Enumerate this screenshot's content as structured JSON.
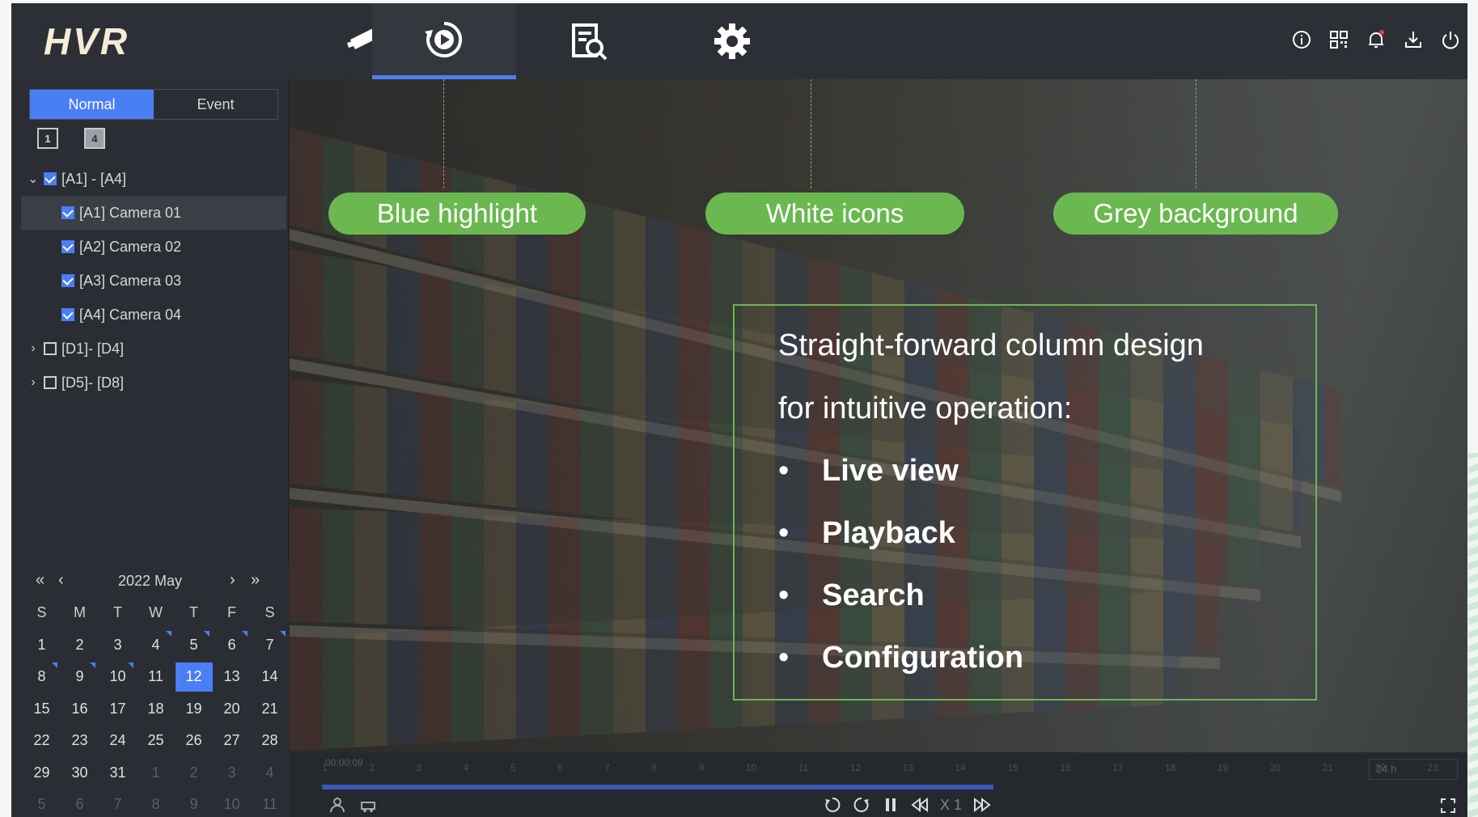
{
  "app": {
    "logo": "HVR"
  },
  "nav": [
    {
      "name": "live-view",
      "icon": "camera-icon"
    },
    {
      "name": "playback",
      "icon": "playback-icon",
      "active": true
    },
    {
      "name": "search",
      "icon": "search-file-icon"
    },
    {
      "name": "configuration",
      "icon": "gear-icon"
    }
  ],
  "header_icons": [
    "info-icon",
    "qr-code-icon",
    "bell-icon",
    "download-icon",
    "power-icon"
  ],
  "sidebar": {
    "tabs": {
      "normal": "Normal",
      "event": "Event"
    },
    "layouts": {
      "one": "1",
      "four": "4"
    },
    "tree": {
      "group_a": "[A1] - [A4]",
      "cameras": [
        "[A1] Camera 01",
        "[A2] Camera 02",
        "[A3] Camera 03",
        "[A4] Camera 04"
      ],
      "group_d1": "[D1]- [D4]",
      "group_d5": "[D5]- [D8]"
    }
  },
  "calendar": {
    "title": "2022 May",
    "nav": {
      "prev_year": "«",
      "prev_month": "‹",
      "next_month": "›",
      "next_year": "»"
    },
    "dow": [
      "S",
      "M",
      "T",
      "W",
      "T",
      "F",
      "S"
    ],
    "weeks": [
      [
        "1",
        "2",
        "3",
        "4",
        "5",
        "6",
        "7"
      ],
      [
        "8",
        "9",
        "10",
        "11",
        "12",
        "13",
        "14"
      ],
      [
        "15",
        "16",
        "17",
        "18",
        "19",
        "20",
        "21"
      ],
      [
        "22",
        "23",
        "24",
        "25",
        "26",
        "27",
        "28"
      ],
      [
        "29",
        "30",
        "31",
        "1",
        "2",
        "3",
        "4"
      ],
      [
        "5",
        "6",
        "7",
        "8",
        "9",
        "10",
        "11"
      ]
    ],
    "today": "12"
  },
  "callouts": {
    "blue": "Blue highlight",
    "white": "White icons",
    "grey": "Grey background"
  },
  "info": {
    "line1": "Straight-forward column design",
    "line2": "for intuitive operation:",
    "bullet_symbol": "•",
    "bullets": [
      "Live view",
      "Playback",
      "Search",
      "Configuration"
    ]
  },
  "timeline": {
    "time": "00:00:09",
    "ticks": [
      "1",
      "2",
      "3",
      "4",
      "5",
      "6",
      "7",
      "8",
      "9",
      "10",
      "11",
      "12",
      "13",
      "14",
      "15",
      "16",
      "17",
      "18",
      "19",
      "20",
      "21",
      "22",
      "23"
    ],
    "range": "24 h",
    "speed": "X 1"
  },
  "colors": {
    "accent": "#4a7ef5",
    "callout": "#6ab84f",
    "background": "#2a2d33"
  }
}
